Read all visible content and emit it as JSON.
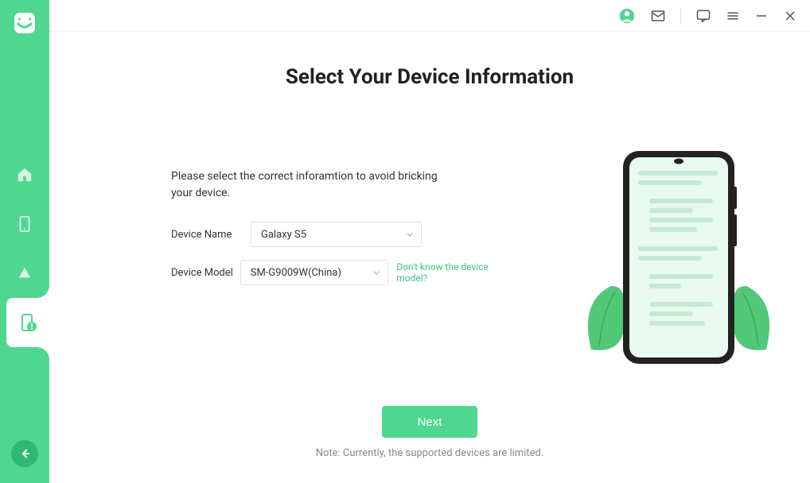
{
  "page": {
    "title": "Select Your Device Information",
    "instruction": "Please select the correct inforamtion to avoid bricking your device.",
    "footer_note": "Note: Currently, the supported devices are limited."
  },
  "form": {
    "device_name_label": "Device Name",
    "device_name_value": "Galaxy S5",
    "device_model_label": "Device Model",
    "device_model_value": "SM-G9009W(China)",
    "help_link": "Don't know the device model?"
  },
  "buttons": {
    "next": "Next"
  },
  "sidebar": {
    "items": [
      "home",
      "phone",
      "cloud",
      "phone-error"
    ],
    "active_index": 3
  },
  "titlebar": {
    "items": [
      "user",
      "mail",
      "divider",
      "chat",
      "menu",
      "minimize",
      "close"
    ]
  },
  "colors": {
    "accent": "#4fd68f",
    "accent_dark": "#2fb871",
    "text": "#333",
    "muted": "#888"
  }
}
